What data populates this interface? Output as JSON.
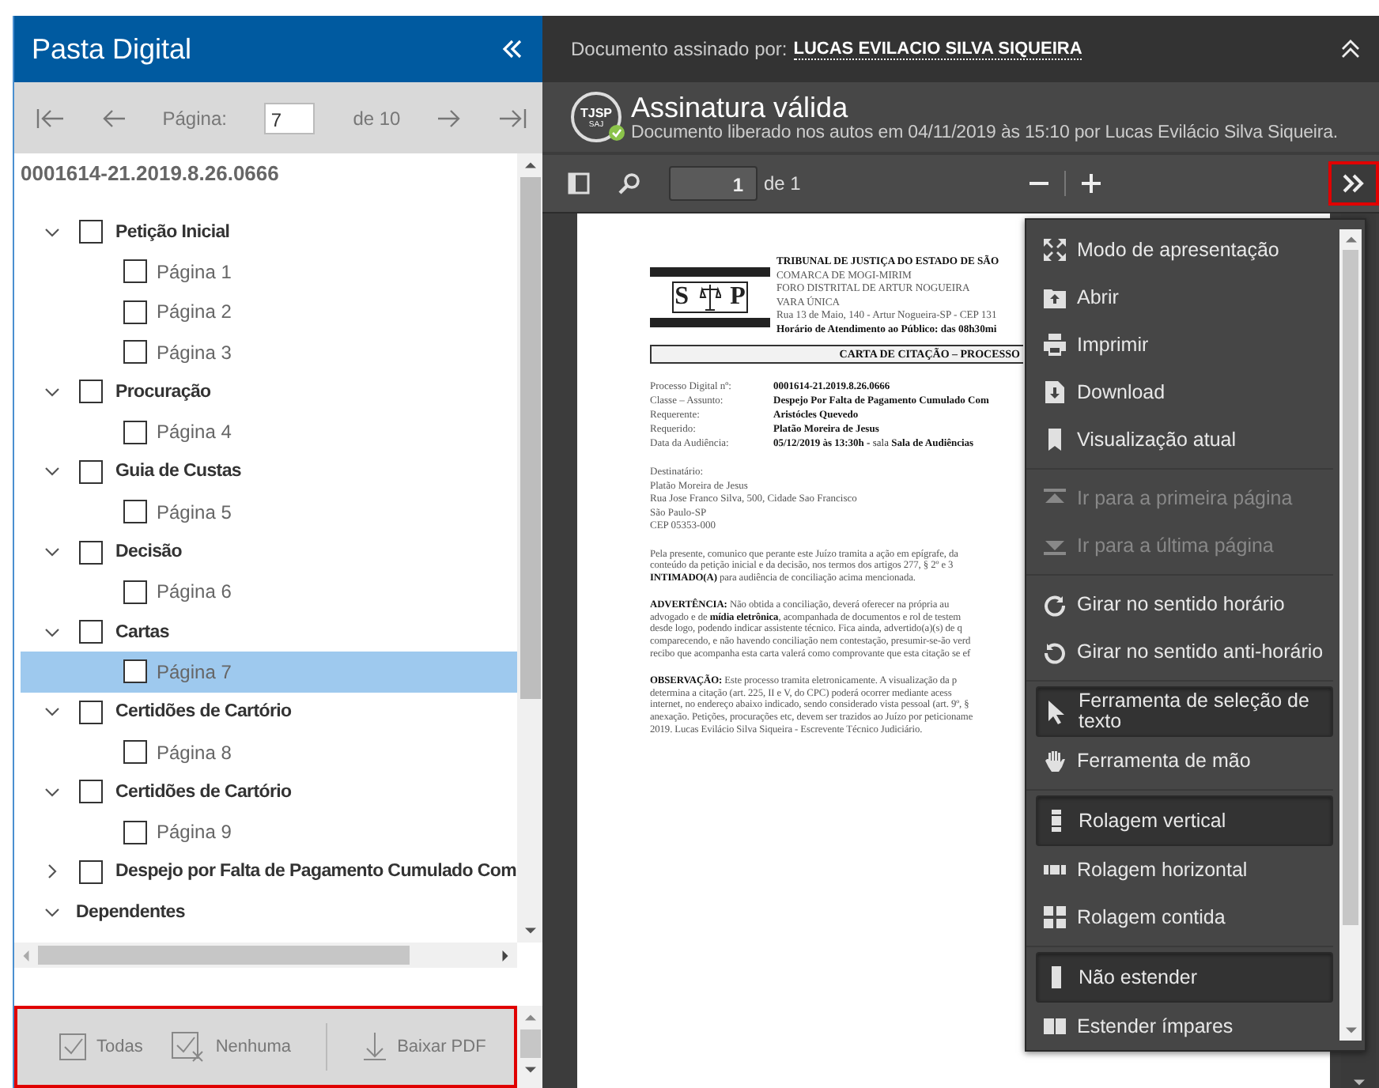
{
  "sidebar": {
    "title": "Pasta Digital",
    "page_label": "Página:",
    "page_value": "7",
    "page_total": "de 10",
    "case_number": "0001614-21.2019.8.26.0666",
    "tree": [
      {
        "kind": "group",
        "label": "Petição Inicial",
        "expanded": true,
        "checked": false,
        "children": [
          {
            "label": "Página 1",
            "checked": false,
            "selected": false
          },
          {
            "label": "Página 2",
            "checked": false,
            "selected": false
          },
          {
            "label": "Página 3",
            "checked": false,
            "selected": false
          }
        ]
      },
      {
        "kind": "group",
        "label": "Procuração",
        "expanded": true,
        "checked": false,
        "children": [
          {
            "label": "Página 4",
            "checked": false,
            "selected": false
          }
        ]
      },
      {
        "kind": "group",
        "label": "Guia de Custas",
        "expanded": true,
        "checked": false,
        "children": [
          {
            "label": "Página 5",
            "checked": false,
            "selected": false
          }
        ]
      },
      {
        "kind": "group",
        "label": "Decisão",
        "expanded": true,
        "checked": false,
        "children": [
          {
            "label": "Página 6",
            "checked": false,
            "selected": false
          }
        ]
      },
      {
        "kind": "group",
        "label": "Cartas",
        "expanded": true,
        "checked": false,
        "children": [
          {
            "label": "Página 7",
            "checked": false,
            "selected": true
          }
        ]
      },
      {
        "kind": "group",
        "label": "Certidões de Cartório",
        "expanded": true,
        "checked": false,
        "children": [
          {
            "label": "Página 8",
            "checked": false,
            "selected": false
          }
        ]
      },
      {
        "kind": "group",
        "label": "Certidões de Cartório",
        "expanded": true,
        "checked": false,
        "children": [
          {
            "label": "Página 9",
            "checked": false,
            "selected": false
          }
        ]
      },
      {
        "kind": "group",
        "label": "Despejo por Falta de Pagamento Cumulado Com",
        "expanded": false,
        "checked": false
      },
      {
        "kind": "section",
        "label": "Dependentes",
        "expanded": true
      }
    ],
    "footer": [
      {
        "label": "Todas"
      },
      {
        "label": "Nenhuma"
      },
      {
        "label": "Baixar PDF"
      }
    ]
  },
  "signature": {
    "signed_by_label": "Documento assinado por:",
    "signer": "LUCAS EVILACIO SILVA SIQUEIRA",
    "badge": "TJSP",
    "badge_sub": "SAJ",
    "status": "Assinatura válida",
    "detail": "Documento liberado nos autos em 04/11/2019 às 15:10 por Lucas Evilácio Silva Siqueira."
  },
  "viewer_toolbar": {
    "page": "1",
    "page_total": "de 1"
  },
  "document": {
    "logo_letters": [
      "S",
      "P"
    ],
    "header": [
      {
        "text": "TRIBUNAL DE JUSTIÇA DO ESTADO DE SÃO",
        "bold": true
      },
      {
        "text": "COMARCA DE MOGI-MIRIM",
        "bold": false
      },
      {
        "text": "FORO DISTRITAL DE ARTUR NOGUEIRA",
        "bold": false
      },
      {
        "text": "VARA ÚNICA",
        "bold": false
      },
      {
        "text": "Rua 13 de Maio, 140 - Artur Nogueira-SP - CEP 131",
        "bold": false
      },
      {
        "text": "Horário de Atendimento ao Público: das 08h30mi",
        "bold": true
      }
    ],
    "title": "CARTA DE CITAÇÃO – PROCESSO",
    "fields": [
      {
        "label": "Processo Digital nº:",
        "value": "**0001614-21.2019.8.26.0666**"
      },
      {
        "label": "Classe – Assunto:",
        "value": "**Despejo Por Falta de Pagamento Cumulado Com**"
      },
      {
        "label": "Requerente:",
        "value": "**Aristócles Quevedo**"
      },
      {
        "label": "Requerido:",
        "value": "**Platão Moreira de Jesus**"
      },
      {
        "label": "Data da Audiência:",
        "value": "**05/12/2019 às 13:30h -** sala **Sala de Audiências**"
      }
    ],
    "address": [
      "Destinatário:",
      "Platão Moreira de Jesus",
      "Rua Jose Franco Silva, 500, Cidade Sao Francisco",
      "São Paulo-SP",
      "CEP 05353-000"
    ],
    "paragraphs": [
      [
        "Pela presente, comunico que perante este Juízo tramita a ação em epígrafe, da",
        "conteúdo da petição inicial e da decisão, nos termos dos artigos 277, § 2º e 3",
        "**INTIMADO(A)** para audiência de conciliação acima mencionada."
      ],
      [
        "**ADVERTÊNCIA:** Não obtida a conciliação, deverá oferecer na própria au",
        "advogado e de **mídia eletrônica**, acompanhada de documentos e rol de testem",
        "desde logo, podendo indicar assistente técnico. Fica ainda, advertido(a)(s) de q",
        "comparecendo, e não havendo conciliação nem contestação, presumir-se-ão verd",
        "recibo que acompanha esta carta valerá como comprovante que esta citação se ef"
      ],
      [
        "**OBSERVAÇÃO:** Este processo tramita eletronicamente. A visualização da p",
        "determina a citação (art. 225, II e V, do CPC) poderá ocorrer mediante acess",
        "internet, no endereço abaixo indicado, sendo considerado vista pessoal (art. 9º, §",
        "anexação. Petições, procurações etc, devem ser trazidos ao Juízo por peticioname",
        "2019. Lucas Evilácio Silva Siqueira - Escrevente Técnico Judiciário."
      ]
    ]
  },
  "menu": {
    "groups": [
      [
        {
          "label": "Modo de apresentação",
          "disabled": false,
          "selected": false
        },
        {
          "label": "Abrir",
          "disabled": false,
          "selected": false
        },
        {
          "label": "Imprimir",
          "disabled": false,
          "selected": false
        },
        {
          "label": "Download",
          "disabled": false,
          "selected": false
        },
        {
          "label": "Visualização atual",
          "disabled": false,
          "selected": false
        }
      ],
      [
        {
          "label": "Ir para a primeira página",
          "disabled": true,
          "selected": false
        },
        {
          "label": "Ir para a última página",
          "disabled": true,
          "selected": false
        }
      ],
      [
        {
          "label": "Girar no sentido horário",
          "disabled": false,
          "selected": false
        },
        {
          "label": "Girar no sentido anti-horário",
          "disabled": false,
          "selected": false
        }
      ],
      [
        {
          "label": "Ferramenta de seleção de texto",
          "disabled": false,
          "selected": true
        },
        {
          "label": "Ferramenta de mão",
          "disabled": false,
          "selected": false
        }
      ],
      [
        {
          "label": "Rolagem vertical",
          "disabled": false,
          "selected": true
        },
        {
          "label": "Rolagem horizontal",
          "disabled": false,
          "selected": false
        },
        {
          "label": "Rolagem contida",
          "disabled": false,
          "selected": false
        }
      ],
      [
        {
          "label": "Não estender",
          "disabled": false,
          "selected": true
        },
        {
          "label": "Estender ímpares",
          "disabled": false,
          "selected": false
        }
      ]
    ]
  }
}
